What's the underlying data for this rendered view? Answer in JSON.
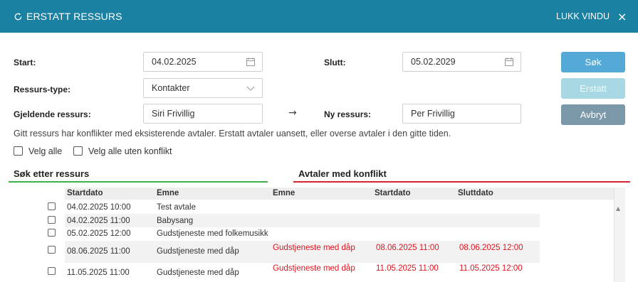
{
  "header": {
    "title": "ERSTATT RESSURS",
    "close_label": "LUKK VINDU",
    "close_icon": "×"
  },
  "form": {
    "start_label": "Start:",
    "start_value": "04.02.2025",
    "end_label": "Slutt:",
    "end_value": "05.02.2029",
    "resource_type_label": "Ressurs-type:",
    "resource_type_value": "Kontakter",
    "current_resource_label": "Gjeldende ressurs:",
    "current_resource_value": "Siri Frivillig",
    "new_resource_label": "Ny ressurs:",
    "new_resource_value": "Per Frivillig"
  },
  "buttons": {
    "search": "Søk",
    "replace": "Erstatt",
    "cancel": "Avbryt"
  },
  "info_text": "Gitt ressurs har konflikter med eksisterende avtaler. Erstatt avtaler uansett, eller overse avtaler i den gitte tiden.",
  "checkboxes": {
    "select_all": "Velg alle",
    "select_all_no_conflict": "Velg alle uten konflikt"
  },
  "sections": {
    "search_resource": "Søk etter ressurs",
    "conflicts": "Avtaler med konflikt"
  },
  "colors": {
    "header": "#1b81a3",
    "search_line": "#3cb24a",
    "conflict_line": "#d9262e",
    "conflict_text": "#e0141e"
  },
  "table": {
    "columns": [
      "Startdato",
      "Emne",
      "Emne",
      "Startdato",
      "Sluttdato"
    ],
    "rows": [
      {
        "start": "04.02.2025 10:00",
        "subject": "Test avtale",
        "conflict_subject": "",
        "conflict_start": "",
        "conflict_end": ""
      },
      {
        "start": "04.02.2025 11:00",
        "subject": "Babysang",
        "conflict_subject": "",
        "conflict_start": "",
        "conflict_end": ""
      },
      {
        "start": "05.02.2025 12:00",
        "subject": "Gudstjeneste med folkemusikk",
        "conflict_subject": "",
        "conflict_start": "",
        "conflict_end": ""
      },
      {
        "start": "08.06.2025 11:00",
        "subject": "Gudstjeneste med dåp",
        "conflict_subject": "Gudstjeneste med dåp",
        "conflict_start": "08.06.2025 11:00",
        "conflict_end": "08.06.2025 12:00"
      },
      {
        "start": "11.05.2025 11:00",
        "subject": "Gudstjeneste med dåp",
        "conflict_subject": "Gudstjeneste med dåp",
        "conflict_start": "11.05.2025 11:00",
        "conflict_end": "11.05.2025 12:00"
      }
    ]
  }
}
